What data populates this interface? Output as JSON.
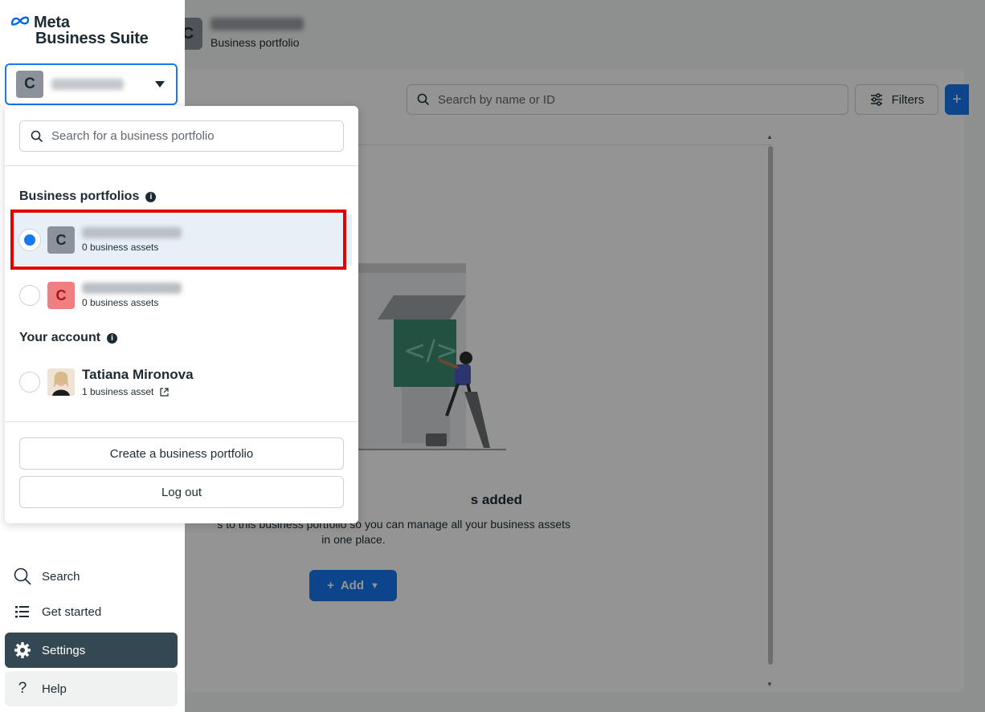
{
  "app": {
    "logo_line1": "Meta",
    "logo_line2": "Business Suite",
    "current_portfolio_initial": "C"
  },
  "background": {
    "header_avatar_initial": "C",
    "header_subtitle": "Business portfolio",
    "search_placeholder": "Search by name or ID",
    "filters_label": "Filters",
    "add_top_icon": "+",
    "empty_title": "s added",
    "empty_desc_line1": "s to this business portfolio so you can manage all your business assets",
    "empty_desc_line2": "in one place.",
    "add_button_label": "Add"
  },
  "dropdown": {
    "search_placeholder": "Search for a business portfolio",
    "portfolios_title": "Business portfolios",
    "portfolios": [
      {
        "initial": "C",
        "assets": "0 business assets",
        "selected": true,
        "color": "#8b9299"
      },
      {
        "initial": "C",
        "assets": "0 business assets",
        "selected": false,
        "color": "#f08080"
      }
    ],
    "account_title": "Your account",
    "account": {
      "name": "Tatiana Mironova",
      "assets": "1 business asset"
    },
    "create_button": "Create a business portfolio",
    "logout_button": "Log out"
  },
  "nav": {
    "search": "Search",
    "get_started": "Get started",
    "settings": "Settings",
    "help": "Help"
  },
  "colors": {
    "accent": "#1877f2",
    "active_nav": "#344854",
    "highlight": "#e00000"
  }
}
